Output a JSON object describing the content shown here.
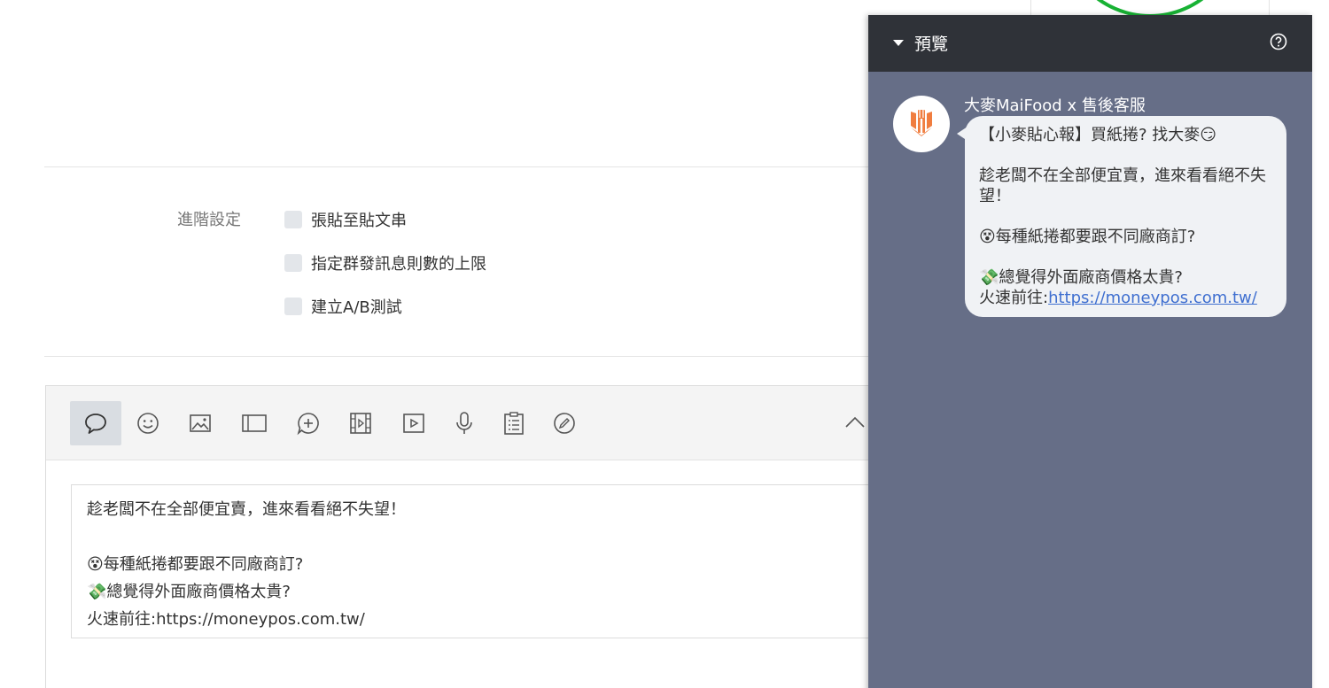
{
  "advanced": {
    "label": "進階設定",
    "options": [
      {
        "label": "張貼至貼文串",
        "checked": false
      },
      {
        "label": "指定群發訊息則數的上限",
        "checked": false
      },
      {
        "label": "建立A/B測試",
        "checked": false
      }
    ]
  },
  "toolbar": {
    "tools": [
      "text-message",
      "sticker",
      "image",
      "card",
      "rich-message",
      "video-message",
      "video",
      "voice",
      "survey",
      "coupon"
    ],
    "active": "text-message"
  },
  "editor": {
    "line1": "趁老闆不在全部便宜賣，進來看看絕不失望！",
    "line2_emoji": "😵",
    "line2_text": "每種紙捲都要跟不同廠商訂?",
    "line3_emoji": "💸",
    "line3_text": "總覺得外面廠商價格太貴?",
    "line4": "火速前往:https://moneypos.com.tw/"
  },
  "preview": {
    "title": "預覽",
    "sender": "大麥MaiFood x 售後客服",
    "msg_line1": "【小麥貼心報】買紙捲? 找大麥",
    "msg_line1_emoji": "😏",
    "msg_line2": "趁老闆不在全部便宜賣，進來看看絕不失望！",
    "msg_line3_emoji": "😵",
    "msg_line3": "每種紙捲都要跟不同廠商訂?",
    "msg_line4_emoji": "💸",
    "msg_line4": "總覺得外面廠商價格太貴?",
    "msg_line5_prefix": "火速前往:",
    "msg_link": "https://moneypos.com.tw/"
  },
  "colors": {
    "preview_bg": "#666e87",
    "preview_header": "#2f3238",
    "link": "#3f6fd0",
    "brand_orange": "#f07d3f",
    "green_accent": "#18b234"
  }
}
